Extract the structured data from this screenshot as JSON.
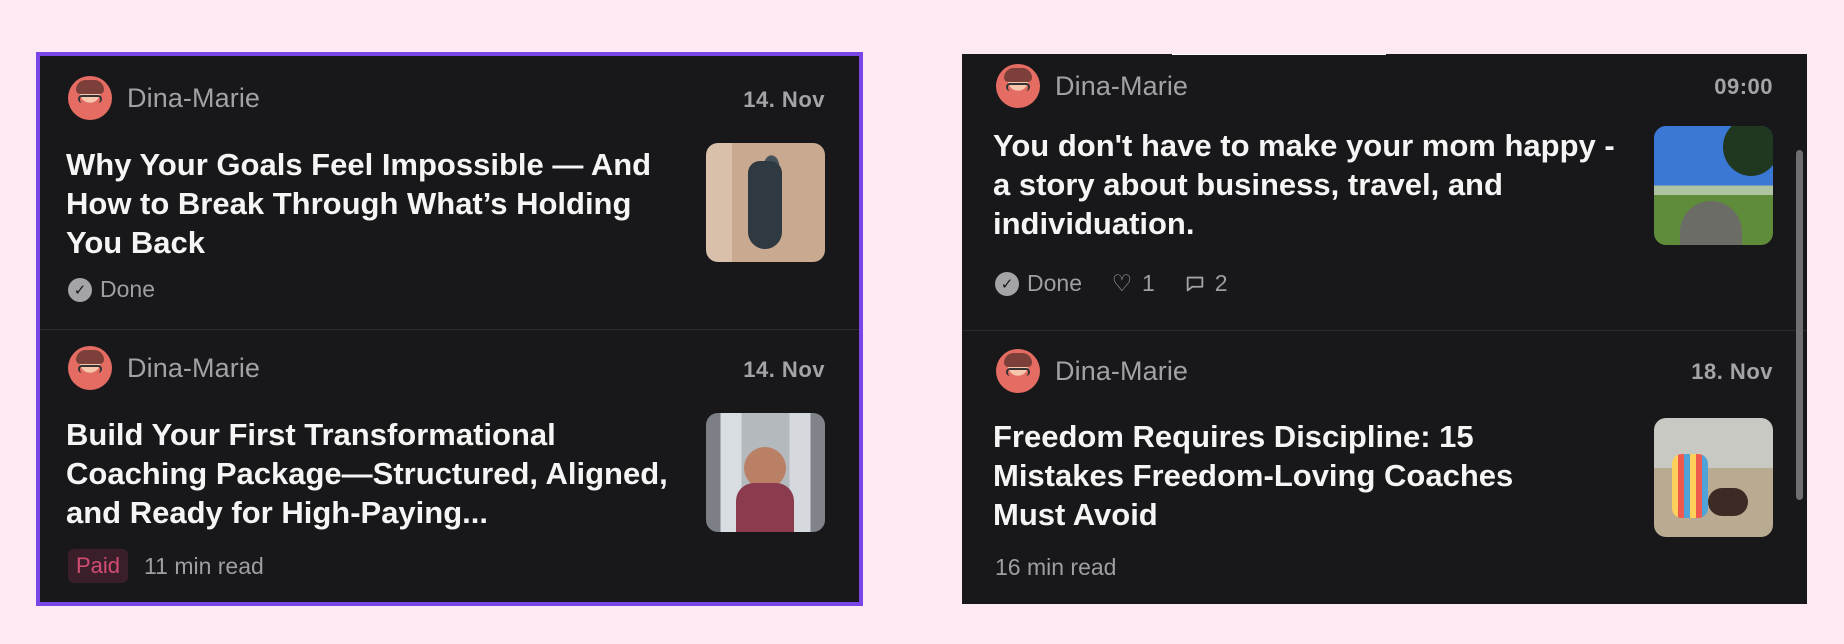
{
  "left_panel": {
    "posts": [
      {
        "author": "Dina-Marie",
        "date": "14. Nov",
        "title": "Why Your Goals Feel Impossible — And How to Break Through What’s Holding You Back",
        "status": "Done",
        "status_icon": "check-circle-icon",
        "thumbnail_icon": "statue-photo-thumbnail"
      },
      {
        "author": "Dina-Marie",
        "date": "14. Nov",
        "title": "Build Your First Transformational Coaching Package—Structured, Aligned, and Ready for High-Paying...",
        "badge": "Paid",
        "read_time": "11 min read",
        "thumbnail_icon": "selfie-photo-thumbnail"
      }
    ]
  },
  "right_panel": {
    "posts": [
      {
        "author": "Dina-Marie",
        "date": "09:00",
        "title": "You don't have to make your mom happy - a story about business, travel, and individuation.",
        "status": "Done",
        "likes": "1",
        "comments": "2",
        "status_icon": "check-circle-icon",
        "like_icon": "heart-icon",
        "comment_icon": "comment-icon",
        "thumbnail_icon": "field-photo-thumbnail"
      },
      {
        "author": "Dina-Marie",
        "date": "18. Nov",
        "title": "Freedom Requires Discipline: 15 Mistakes Freedom-Loving Coaches Must Avoid",
        "read_time": "16 min read",
        "thumbnail_icon": "beach-photo-thumbnail"
      }
    ]
  },
  "colors": {
    "page_background": "#fce9f2",
    "panel_background": "#18181a",
    "selection_border": "#7a45e6",
    "title_text": "#f5f5f6",
    "muted_text": "#a2a2a6",
    "paid_badge_text": "#d24d71",
    "paid_badge_background": "#3a1f2b"
  }
}
